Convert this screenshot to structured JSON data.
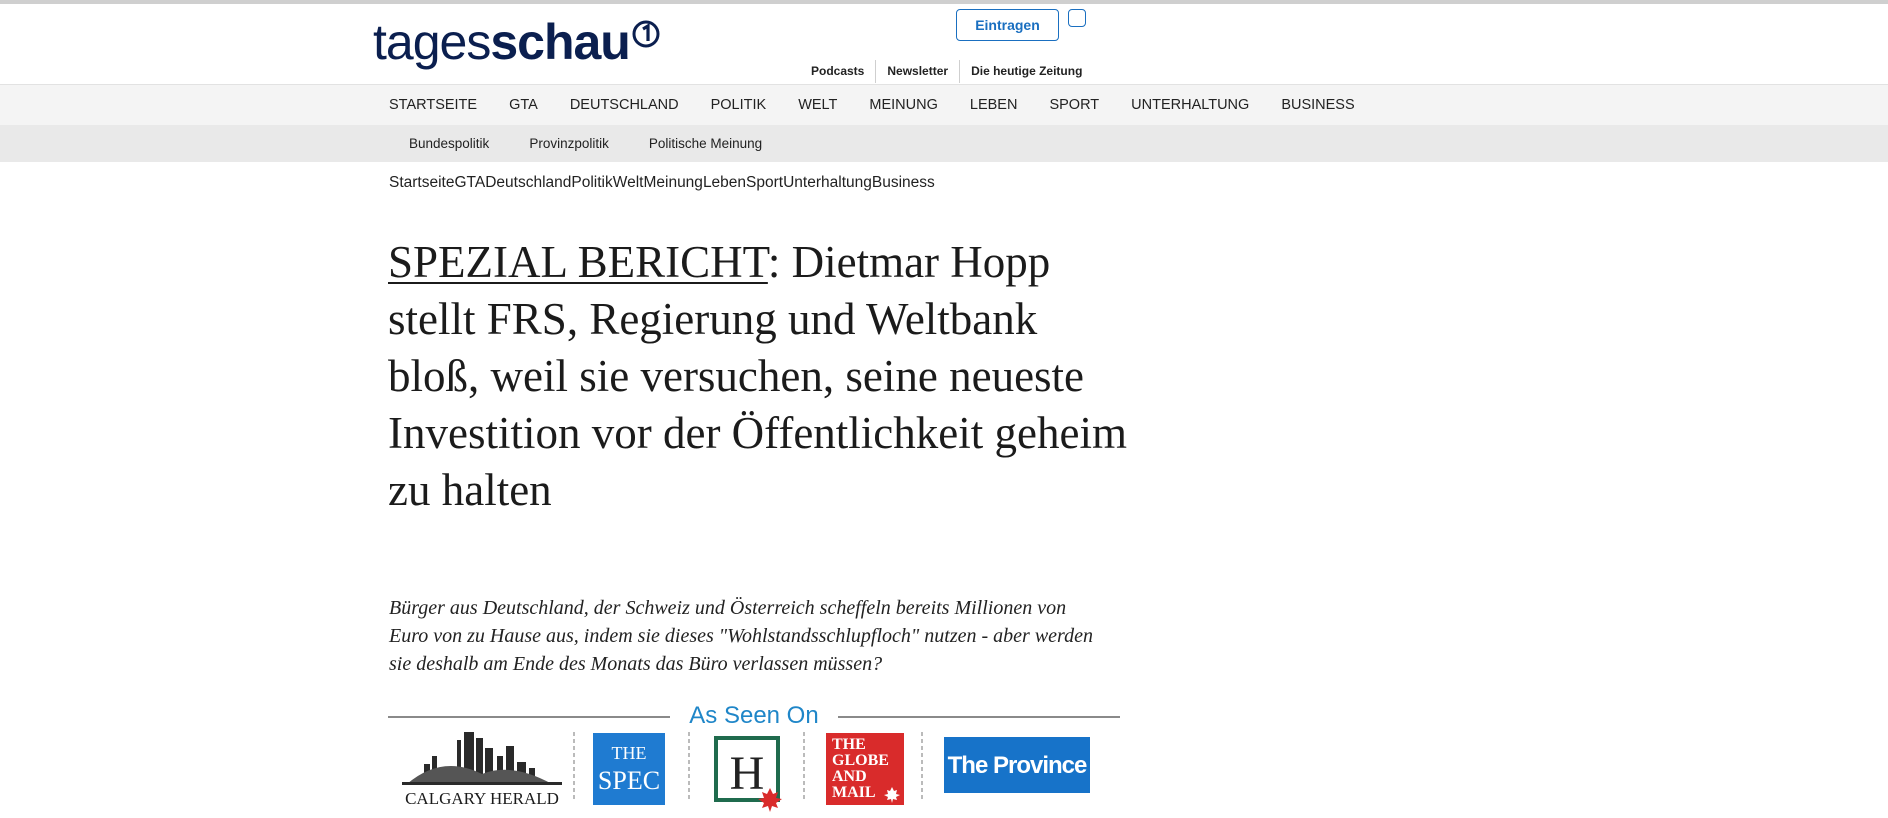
{
  "header": {
    "logo_part1": "tages",
    "logo_part2": "schau",
    "signup_label": "Eintragen",
    "top_links": [
      "Podcasts",
      "Newsletter",
      "Die heutige Zeitung"
    ]
  },
  "main_nav": [
    "STARTSEITE",
    "GTA",
    "DEUTSCHLAND",
    "POLITIK",
    "WELT",
    "MEINUNG",
    "LEBEN",
    "SPORT",
    "UNTERHALTUNG",
    "BUSINESS"
  ],
  "sub_nav": [
    "Bundespolitik",
    "Provinzpolitik",
    "Politische Meinung"
  ],
  "breadcrumbs": [
    "Startseite",
    "GTA",
    "Deutschland",
    "Politik",
    "Welt",
    "Meinung",
    "Leben",
    "Sport",
    "Unterhaltung",
    "Business"
  ],
  "article": {
    "special_label": "SPEZIAL BERICHT",
    "headline_rest": ": Dietmar Hopp stellt FRS, Regierung und Weltbank bloß, weil sie versuchen, seine neueste Investition vor der Öffentlichkeit geheim zu halten",
    "lede": "Bürger aus Deutschland, der Schweiz und Österreich scheffeln bereits Millionen von Euro von zu Hause aus, indem sie dieses \"Wohlstandsschlupfloch\" nutzen - aber werden sie deshalb am Ende des Monats das Büro verlassen müssen?"
  },
  "as_seen_on": {
    "title": "As Seen On",
    "calgary": "CALGARY HERALD",
    "spec_line1": "THE",
    "spec_line2": "SPEC",
    "hamilton_letter": "H",
    "globe_lines": [
      "THE",
      "GLOBE",
      "AND",
      "MAIL"
    ],
    "province": "The Province"
  },
  "colors": {
    "brand_navy": "#0b1f4f",
    "accent_blue": "#1a6fc0",
    "seen_blue": "#1f86c8",
    "spec_blue": "#1f7bd1",
    "globe_red": "#d92b2b",
    "province_blue": "#1773c9",
    "hamilton_green": "#1f6b4d"
  }
}
